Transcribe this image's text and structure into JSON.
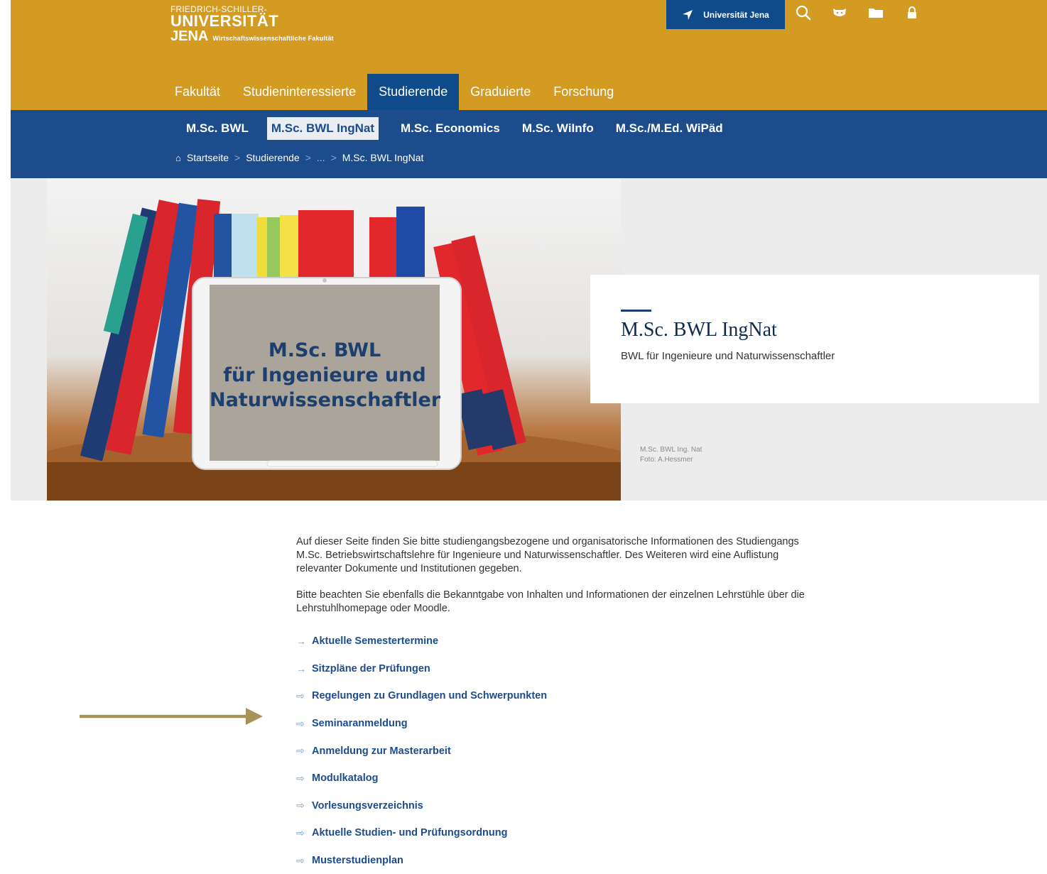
{
  "header": {
    "logo_line1": "FRIEDRICH-SCHILLER-",
    "logo_line2": "UNIVERSITÄT",
    "logo_line3": "JENA",
    "logo_faculty": "Wirtschaftswissenschaftliche Fakultät",
    "university_button": "Universität Jena",
    "icons": [
      "location-arrow-icon",
      "search-icon",
      "cat-icon",
      "folder-icon",
      "lock-icon"
    ]
  },
  "main_nav": [
    "Fakultät",
    "Studieninteressierte",
    "Studierende",
    "Graduierte",
    "Forschung"
  ],
  "main_nav_active": "Studierende",
  "sub_nav": [
    "M.Sc. BWL",
    "M.Sc. BWL IngNat",
    "M.Sc. Economics",
    "M.Sc. WiInfo",
    "M.Sc./M.Ed. WiPäd"
  ],
  "sub_nav_active": "M.Sc. BWL IngNat",
  "breadcrumb": {
    "home": "Startseite",
    "item2": "Studierende",
    "ellipsis": "...",
    "current": "M.Sc. BWL IngNat",
    "separator": ">"
  },
  "hero": {
    "tablet_text_line1": "M.Sc. BWL",
    "tablet_text_line2": "für Ingenieure und",
    "tablet_text_line3": "Naturwissenschaftler",
    "card_title": "M.Sc. BWL IngNat",
    "card_subtitle": "BWL für Ingenieure und Naturwissenschaftler",
    "caption_line1": "M.Sc. BWL Ing. Nat",
    "caption_line2": "Foto: A.Hessmer"
  },
  "content": {
    "paragraph1": "Auf dieser Seite finden Sie bitte studiengangsbezogene und organisatorische Informationen des Studiengangs M.Sc. Betriebswirtschaftslehre für Ingenieure und Naturwissenschaftler. Des Weiteren wird eine Auflistung relevanter Dokumente  und Institutionen gegeben.",
    "paragraph2": "Bitte beachten Sie ebenfalls die Bekanntgabe von Inhalten und Informationen der einzelnen Lehrstühle über die Lehrstuhlhomepage oder Moodle.",
    "links": [
      {
        "label": "Aktuelle Semestertermine",
        "icon": "→"
      },
      {
        "label": "Sitzpläne der Prüfungen",
        "icon": "→"
      },
      {
        "label": "Regelungen zu Grundlagen und Schwerpunkten",
        "icon": "⇨"
      },
      {
        "label": "Seminaranmeldung",
        "icon": "⇨"
      },
      {
        "label": "Anmeldung zur Masterarbeit",
        "icon": "⇨"
      },
      {
        "label": "Modulkatalog",
        "icon": "⇨"
      },
      {
        "label": "Vorlesungsverzeichnis",
        "icon": "⇨"
      },
      {
        "label": "Aktuelle Studien- und Prüfungsordnung",
        "icon": "⇨"
      },
      {
        "label": "Musterstudienplan",
        "icon": "⇨"
      }
    ]
  },
  "colors": {
    "header_gold": "#d49b23",
    "nav_blue": "#1c4c8c",
    "active_blue": "#0f4a8a",
    "link_blue": "#1c4c8c",
    "annotation_arrow": "#a89258"
  }
}
